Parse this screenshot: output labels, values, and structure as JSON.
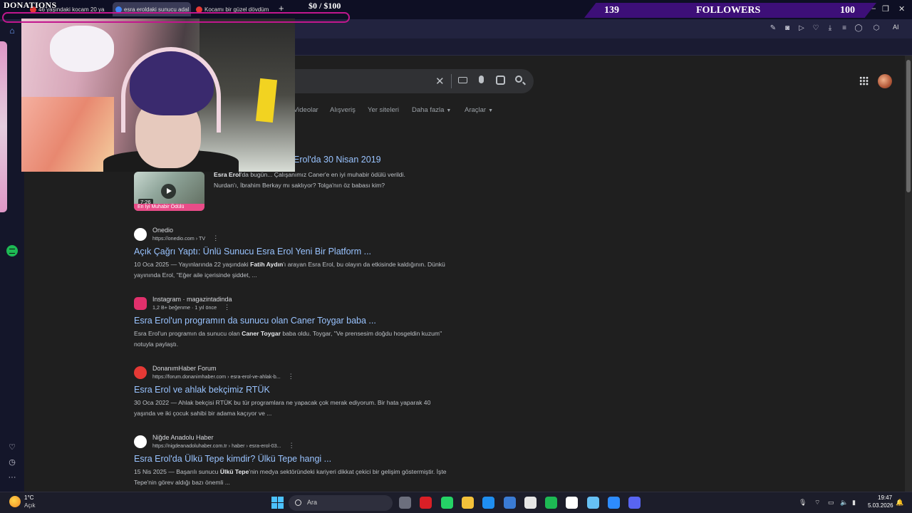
{
  "browser": {
    "tabs": [
      {
        "label": "46 yaşındaki kocam 20 ya",
        "favicon_color": "#e53935"
      },
      {
        "label": "esra eroldaki sunucu adal",
        "favicon_color": "#4285f4"
      },
      {
        "label": "Kocamı bir güzel dövdüm",
        "favicon_color": "#e53935"
      }
    ],
    "new_tab_label": "+",
    "window_controls": [
      "—",
      "❐",
      "✕"
    ],
    "toolbar_icons": [
      "edit-icon",
      "camera-icon",
      "play-icon",
      "heart-icon",
      "download-icon",
      "menu-icon",
      "account-icon",
      "extension-icon"
    ],
    "ai_label": "AI"
  },
  "overlay": {
    "donations_title": "DONATIONS",
    "donations_amount": "$0  / $100",
    "donations_progress": 0.0,
    "followers_current": "139",
    "followers_label": "FOLLOWERS",
    "followers_goal": "100"
  },
  "search": {
    "filters": [
      {
        "label": "Videolar",
        "caret": false
      },
      {
        "label": "Alışveriş",
        "caret": false
      },
      {
        "label": "Yer siteleri",
        "caret": false
      },
      {
        "label": "Daha fazla",
        "caret": true
      },
      {
        "label": "Araçlar",
        "caret": true
      }
    ],
    "video_result": {
      "title_partial": "Erol'da 30 Nisan 2019",
      "duration": "7:26",
      "banner": "En İyi Muhabir Ödülü",
      "snippet_bold": "Esra Erol",
      "snippet": "'da bugün... Çalışanımız Caner'e en iyi muhabir ödülü verildi. Nurdan'ı, İbrahim Berkay mı saklıyor? Tolga'nın öz babası kim?"
    },
    "results": [
      {
        "source": "Onedio",
        "url": "https://onedio.com › TV",
        "title": "Açık Çağrı Yaptı: Ünlü Sunucu Esra Erol Yeni Bir Platform ...",
        "snippet_pre": "10 Oca 2025 — Yayınlarında 22 yaşındaki ",
        "snippet_bold": "Fatih Aydın",
        "snippet_post": "'ı arayan Esra Erol, bu olayın da etkisinde kaldığının. Dünkü yayınında Erol, \"Eğer aile içerisinde şiddet, ...",
        "icon_bg": "#ffffff",
        "icon_fg": "#111111",
        "icon_glyph": "◉"
      },
      {
        "source": "Instagram · magazintadinda",
        "url": "1,2 B+ beğenme · 1 yıl önce",
        "title": "Esra Erol'un programın da sunucu olan Caner Toygar baba ...",
        "snippet_pre": "Esra Erol'un programın da sunucu olan ",
        "snippet_bold": "Caner Toygar",
        "snippet_post": " baba oldu. Toygar, \"Ve prensesim doğdu hosgeldin kuzum\" notuyla paylaştı.",
        "icon_bg": "#e1306c",
        "icon_fg": "#ffffff",
        "icon_glyph": "◎"
      },
      {
        "source": "DonanımHaber Forum",
        "url": "https://forum.donanimhaber.com › esra-erol-ve-ahlak-b...",
        "title": "Esra Erol ve ahlak bekçimiz RTÜK",
        "snippet_pre": "30 Oca 2022 — Ahlak bekçisi RTÜK bu tür programlara ne yapacak çok merak ediyorum. Bir hata yaparak 40 yaşında ve iki çocuk sahibi bir adama kaçıyor ve ...",
        "snippet_bold": "",
        "snippet_post": "",
        "icon_bg": "#e53935",
        "icon_fg": "#ffffff",
        "icon_glyph": "DH"
      },
      {
        "source": "Niğde Anadolu Haber",
        "url": "https://nigdeanadoluhaber.com.tr › haber › esra-erol-03...",
        "title": "Esra Erol'da Ülkü Tepe kimdir? Ülkü Tepe hangi ...",
        "snippet_pre": "15 Nis 2025 — Başarılı sunucu ",
        "snippet_bold": "Ülkü Tepe",
        "snippet_post": "'nin medya sektöründeki kariyeri dikkat çekici bir gelişim göstermiştir. İşte Tepe'nin görev aldığı bazı önemli ...",
        "icon_bg": "#ffffff",
        "icon_fg": "#c62828",
        "icon_glyph": "A"
      }
    ],
    "menu_glyph": "⋮"
  },
  "sidebar": {
    "icons": [
      "home-icon",
      "bookmark-icon",
      "spotify-icon",
      "heart-icon",
      "history-icon",
      "more-icon"
    ]
  },
  "taskbar": {
    "weather_temp": "1°C",
    "weather_cond": "Açık",
    "search_label": "Ara",
    "apps": [
      {
        "name": "files-app",
        "color": "#6c6f7d"
      },
      {
        "name": "opera-app",
        "color": "#d91f26"
      },
      {
        "name": "whatsapp-app",
        "color": "#25d366"
      },
      {
        "name": "explorer-app",
        "color": "#f3c13a"
      },
      {
        "name": "edge-app",
        "color": "#1f8ef1"
      },
      {
        "name": "store-app",
        "color": "#3a7bd5"
      },
      {
        "name": "chatgpt-app",
        "color": "#e6e6e6"
      },
      {
        "name": "spotify-app",
        "color": "#1db954"
      },
      {
        "name": "capcut-app",
        "color": "#ffffff"
      },
      {
        "name": "steam-app",
        "color": "#66c0f4"
      },
      {
        "name": "zoom-app",
        "color": "#2d8cff"
      },
      {
        "name": "discord-app",
        "color": "#5865f2"
      }
    ],
    "time": "19:47",
    "date": "5.03.2026"
  }
}
